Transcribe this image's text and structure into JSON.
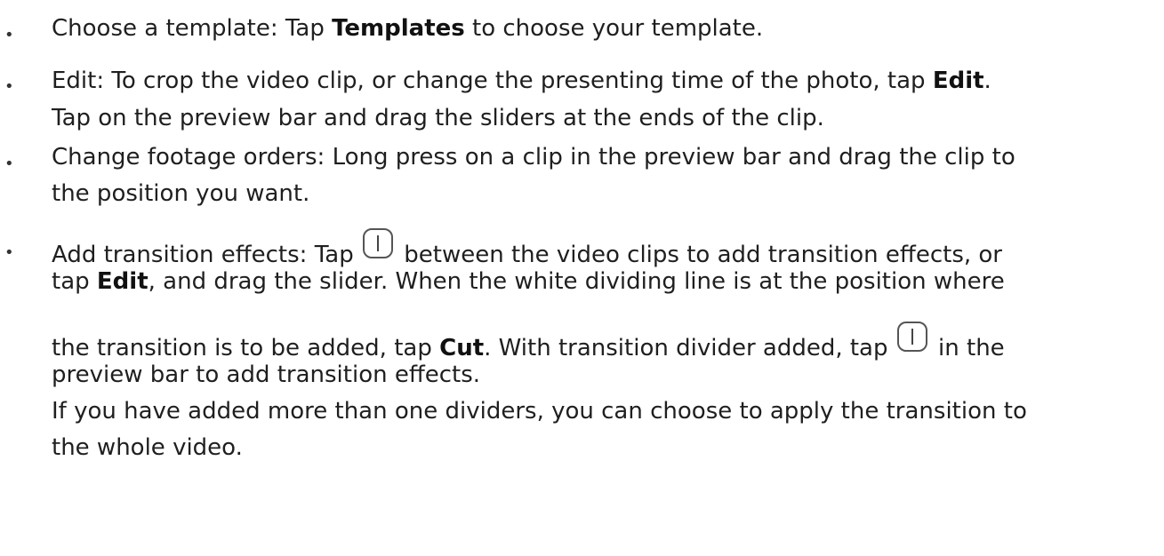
{
  "items": [
    {
      "lines": [
        {
          "a": "Choose a template: Tap ",
          "b": "Templates",
          "c": " to choose your template."
        }
      ]
    },
    {
      "lines": [
        {
          "a": "Edit: To crop the video clip, or change the presenting time of the photo, tap ",
          "b": "Edit",
          "c": "."
        },
        {
          "a": "Tap on the preview bar and drag the sliders at the ends of the clip."
        }
      ]
    },
    {
      "lines": [
        {
          "a": "Change footage orders: Long press on a clip in the preview bar and drag the clip to"
        },
        {
          "a": "the position you want."
        }
      ]
    },
    {
      "lines": [
        {
          "a": "Add transition effects: Tap ",
          "b": "between the video clips to add transition effects, or"
        },
        {
          "a": "tap ",
          "b": "Edit",
          "c": ", and drag the slider. When the white dividing line is at the position where"
        },
        {
          "a": "the transition is to be added, tap ",
          "b": "Cut",
          "c": ". With transition divider added, tap ",
          "d": "in the"
        },
        {
          "a": "preview bar to add transition effects."
        },
        {
          "a": "If you have added more than one dividers, you can choose to apply the transition to"
        },
        {
          "a": "the whole video."
        }
      ]
    }
  ],
  "icons": {
    "divider_button": "transition-divider-icon"
  }
}
